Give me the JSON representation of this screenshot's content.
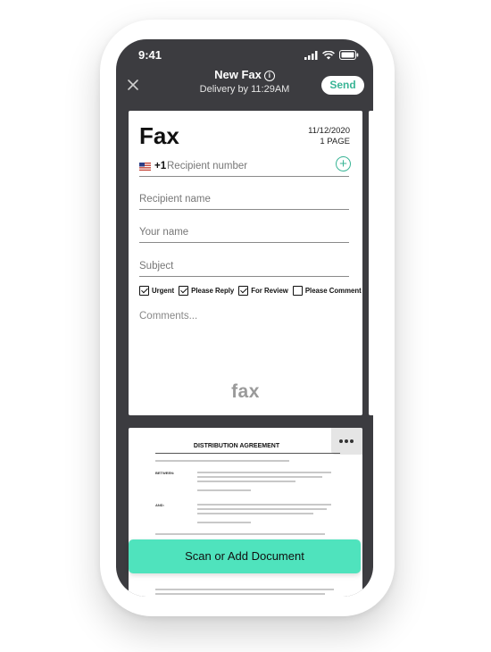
{
  "status": {
    "time": "9:41"
  },
  "nav": {
    "title": "New Fax",
    "subtitle": "Delivery by 11:29AM",
    "send_label": "Send"
  },
  "fax": {
    "title": "Fax",
    "date": "11/12/2020",
    "pages": "1 PAGE",
    "country_code": "+1",
    "recipient_number_placeholder": "Recipient number",
    "recipient_name_placeholder": "Recipient name",
    "your_name_placeholder": "Your name",
    "subject_placeholder": "Subject",
    "checkboxes": [
      {
        "label": "Urgent",
        "checked": true
      },
      {
        "label": "Please Reply",
        "checked": true
      },
      {
        "label": "For Review",
        "checked": true
      },
      {
        "label": "Please Comment",
        "checked": false
      }
    ],
    "comments_placeholder": "Comments...",
    "watermark": "fax"
  },
  "document": {
    "title": "DISTRIBUTION AGREEMENT",
    "labels": [
      "BETWEEN:",
      "AND:"
    ]
  },
  "scan_button_label": "Scan or Add Document",
  "colors": {
    "accent": "#3ab596",
    "button": "#4fe3bd",
    "screen_bg": "#3c3c40"
  }
}
